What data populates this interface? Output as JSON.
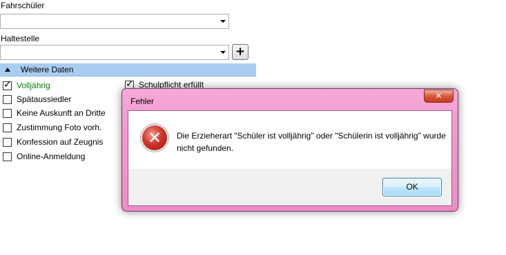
{
  "form": {
    "fahrschueler_label": "Fahrschüler",
    "haltestelle_label": "Haltestelle",
    "add_label": "+",
    "section_title": "Weitere Daten",
    "checkboxes_left": [
      {
        "label": "Volljährig",
        "checked": true
      },
      {
        "label": "Spätaussiedler",
        "checked": false
      },
      {
        "label": "Keine Auskunft an Dritte",
        "checked": false
      },
      {
        "label": "Zustimmung Foto vorh.",
        "checked": false
      },
      {
        "label": "Konfession auf Zeugnis",
        "checked": false
      },
      {
        "label": "Online-Anmeldung",
        "checked": false
      }
    ],
    "checkbox_right": {
      "label": "Schulpflicht erfüllt",
      "checked": true
    }
  },
  "dialog": {
    "title": "Fehler",
    "close_label": "✕",
    "message": "Die Erzieherart \"Schüler ist volljährig\" oder \"Schülerin ist volljährig\" wurde nicht gefunden.",
    "ok_label": "OK",
    "icon": "error-icon"
  },
  "colors": {
    "section_bar": "#a9cdf0",
    "highlight_text": "#008000",
    "dialog_frame": "#f39ad0",
    "close_button": "#c63a1d"
  }
}
